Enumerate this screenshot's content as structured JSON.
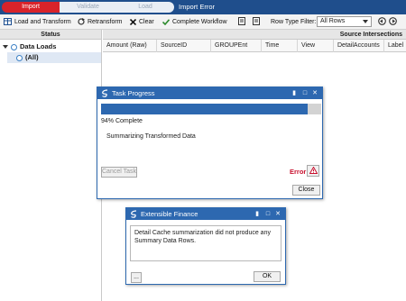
{
  "workflow": {
    "steps": [
      {
        "label": "Import",
        "state": "active"
      },
      {
        "label": "Validate",
        "state": "inactive"
      },
      {
        "label": "Load",
        "state": "inactive"
      }
    ],
    "title": "Import Error",
    "colors": {
      "bar": "#1f4e8c",
      "active_step": "#d8232a"
    }
  },
  "toolbar": {
    "load_transform": "Load and Transform",
    "retransform": "Retransform",
    "clear": "Clear",
    "complete_workflow": "Complete Workflow",
    "row_type_filter_label": "Row Type Filter:",
    "row_type_filter_value": "All Rows",
    "icons": [
      "grid-icon",
      "refresh-icon",
      "close-x-icon",
      "checkmark-icon",
      "document-icon",
      "document-icon",
      "nav-back-icon",
      "nav-forward-icon"
    ]
  },
  "status_panel": {
    "header": "Status",
    "tree": [
      {
        "label": "Data Loads",
        "level": 0
      },
      {
        "label": "(All)",
        "level": 1,
        "selected": true
      }
    ]
  },
  "grid": {
    "group_header": "Source Intersections",
    "columns": [
      "Amount (Raw)",
      "SourceID",
      "GROUPEnt",
      "Time",
      "View",
      "DetailAccounts",
      "Label"
    ]
  },
  "task_progress": {
    "title": "Task Progress",
    "progress_percent": 94,
    "complete_text": "94% Complete",
    "status_text": "Summarizing Transformed Data",
    "cancel_label": "Cancel Task",
    "error_label": "Error",
    "close_label": "Close",
    "error_color": "#c8102e"
  },
  "message_dialog": {
    "title": "Extensible Finance",
    "message": "Detail Cache summarization did not produce any Summary Data Rows.",
    "more_label": "...",
    "ok_label": "OK"
  }
}
